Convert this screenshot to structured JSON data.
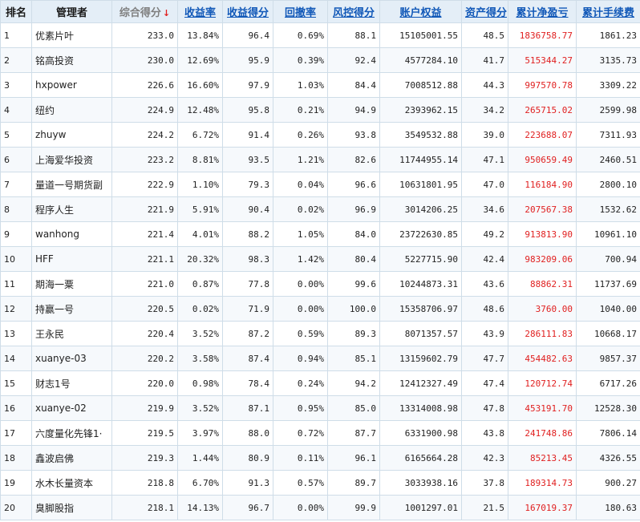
{
  "headers": {
    "rank": "排名",
    "manager": "管理者",
    "composite": "综合得分",
    "sort_icon": "down-arrow",
    "return_rate": "收益率",
    "return_score": "收益得分",
    "drawdown": "回撤率",
    "risk_score": "风控得分",
    "equity": "账户权益",
    "asset_score": "资产得分",
    "cum_pnl": "累计净盈亏",
    "cum_fee": "累计手续费"
  },
  "colors": {
    "link": "#1158b8",
    "profit": "#e02020",
    "header_bg": "#e4eef7"
  },
  "rows": [
    {
      "rank": "1",
      "manager": "优素片叶",
      "composite": "233.0",
      "return_rate": "13.84%",
      "return_score": "96.4",
      "drawdown": "0.69%",
      "risk_score": "88.1",
      "equity": "15105001.55",
      "asset_score": "48.5",
      "cum_pnl": "1836758.77",
      "cum_fee": "1861.23"
    },
    {
      "rank": "2",
      "manager": "铭高投资",
      "composite": "230.0",
      "return_rate": "12.69%",
      "return_score": "95.9",
      "drawdown": "0.39%",
      "risk_score": "92.4",
      "equity": "4577284.10",
      "asset_score": "41.7",
      "cum_pnl": "515344.27",
      "cum_fee": "3135.73"
    },
    {
      "rank": "3",
      "manager": "hxpower",
      "composite": "226.6",
      "return_rate": "16.60%",
      "return_score": "97.9",
      "drawdown": "1.03%",
      "risk_score": "84.4",
      "equity": "7008512.88",
      "asset_score": "44.3",
      "cum_pnl": "997570.78",
      "cum_fee": "3309.22"
    },
    {
      "rank": "4",
      "manager": "纽约",
      "composite": "224.9",
      "return_rate": "12.48%",
      "return_score": "95.8",
      "drawdown": "0.21%",
      "risk_score": "94.9",
      "equity": "2393962.15",
      "asset_score": "34.2",
      "cum_pnl": "265715.02",
      "cum_fee": "2599.98"
    },
    {
      "rank": "5",
      "manager": "zhuyw",
      "composite": "224.2",
      "return_rate": "6.72%",
      "return_score": "91.4",
      "drawdown": "0.26%",
      "risk_score": "93.8",
      "equity": "3549532.88",
      "asset_score": "39.0",
      "cum_pnl": "223688.07",
      "cum_fee": "7311.93"
    },
    {
      "rank": "6",
      "manager": "上海爱华投资",
      "composite": "223.2",
      "return_rate": "8.81%",
      "return_score": "93.5",
      "drawdown": "1.21%",
      "risk_score": "82.6",
      "equity": "11744955.14",
      "asset_score": "47.1",
      "cum_pnl": "950659.49",
      "cum_fee": "2460.51"
    },
    {
      "rank": "7",
      "manager": "量道一号期货副",
      "composite": "222.9",
      "return_rate": "1.10%",
      "return_score": "79.3",
      "drawdown": "0.04%",
      "risk_score": "96.6",
      "equity": "10631801.95",
      "asset_score": "47.0",
      "cum_pnl": "116184.90",
      "cum_fee": "2800.10"
    },
    {
      "rank": "8",
      "manager": "程序人生",
      "composite": "221.9",
      "return_rate": "5.91%",
      "return_score": "90.4",
      "drawdown": "0.02%",
      "risk_score": "96.9",
      "equity": "3014206.25",
      "asset_score": "34.6",
      "cum_pnl": "207567.38",
      "cum_fee": "1532.62"
    },
    {
      "rank": "9",
      "manager": "wanhong",
      "composite": "221.4",
      "return_rate": "4.01%",
      "return_score": "88.2",
      "drawdown": "1.05%",
      "risk_score": "84.0",
      "equity": "23722630.85",
      "asset_score": "49.2",
      "cum_pnl": "913813.90",
      "cum_fee": "10961.10"
    },
    {
      "rank": "10",
      "manager": "HFF",
      "composite": "221.1",
      "return_rate": "20.32%",
      "return_score": "98.3",
      "drawdown": "1.42%",
      "risk_score": "80.4",
      "equity": "5227715.90",
      "asset_score": "42.4",
      "cum_pnl": "983209.06",
      "cum_fee": "700.94"
    },
    {
      "rank": "11",
      "manager": "期海一粟",
      "composite": "221.0",
      "return_rate": "0.87%",
      "return_score": "77.8",
      "drawdown": "0.00%",
      "risk_score": "99.6",
      "equity": "10244873.31",
      "asset_score": "43.6",
      "cum_pnl": "88862.31",
      "cum_fee": "11737.69"
    },
    {
      "rank": "12",
      "manager": "持赢一号",
      "composite": "220.5",
      "return_rate": "0.02%",
      "return_score": "71.9",
      "drawdown": "0.00%",
      "risk_score": "100.0",
      "equity": "15358706.97",
      "asset_score": "48.6",
      "cum_pnl": "3760.00",
      "cum_fee": "1040.00"
    },
    {
      "rank": "13",
      "manager": "王永民",
      "composite": "220.4",
      "return_rate": "3.52%",
      "return_score": "87.2",
      "drawdown": "0.59%",
      "risk_score": "89.3",
      "equity": "8071357.57",
      "asset_score": "43.9",
      "cum_pnl": "286111.83",
      "cum_fee": "10668.17"
    },
    {
      "rank": "14",
      "manager": "xuanye-03",
      "composite": "220.2",
      "return_rate": "3.58%",
      "return_score": "87.4",
      "drawdown": "0.94%",
      "risk_score": "85.1",
      "equity": "13159602.79",
      "asset_score": "47.7",
      "cum_pnl": "454482.63",
      "cum_fee": "9857.37"
    },
    {
      "rank": "15",
      "manager": "财志1号",
      "composite": "220.0",
      "return_rate": "0.98%",
      "return_score": "78.4",
      "drawdown": "0.24%",
      "risk_score": "94.2",
      "equity": "12412327.49",
      "asset_score": "47.4",
      "cum_pnl": "120712.74",
      "cum_fee": "6717.26"
    },
    {
      "rank": "16",
      "manager": "xuanye-02",
      "composite": "219.9",
      "return_rate": "3.52%",
      "return_score": "87.1",
      "drawdown": "0.95%",
      "risk_score": "85.0",
      "equity": "13314008.98",
      "asset_score": "47.8",
      "cum_pnl": "453191.70",
      "cum_fee": "12528.30"
    },
    {
      "rank": "17",
      "manager": "六度量化先锋1·",
      "composite": "219.5",
      "return_rate": "3.97%",
      "return_score": "88.0",
      "drawdown": "0.72%",
      "risk_score": "87.7",
      "equity": "6331900.98",
      "asset_score": "43.8",
      "cum_pnl": "241748.86",
      "cum_fee": "7806.14"
    },
    {
      "rank": "18",
      "manager": "鑫波启佛",
      "composite": "219.3",
      "return_rate": "1.44%",
      "return_score": "80.9",
      "drawdown": "0.11%",
      "risk_score": "96.1",
      "equity": "6165664.28",
      "asset_score": "42.3",
      "cum_pnl": "85213.45",
      "cum_fee": "4326.55"
    },
    {
      "rank": "19",
      "manager": "水木长量资本",
      "composite": "218.8",
      "return_rate": "6.70%",
      "return_score": "91.3",
      "drawdown": "0.57%",
      "risk_score": "89.7",
      "equity": "3033938.16",
      "asset_score": "37.8",
      "cum_pnl": "189314.73",
      "cum_fee": "900.27"
    },
    {
      "rank": "20",
      "manager": "臭脚股指",
      "composite": "218.1",
      "return_rate": "14.13%",
      "return_score": "96.7",
      "drawdown": "0.00%",
      "risk_score": "99.9",
      "equity": "1001297.01",
      "asset_score": "21.5",
      "cum_pnl": "167019.37",
      "cum_fee": "180.63"
    }
  ]
}
